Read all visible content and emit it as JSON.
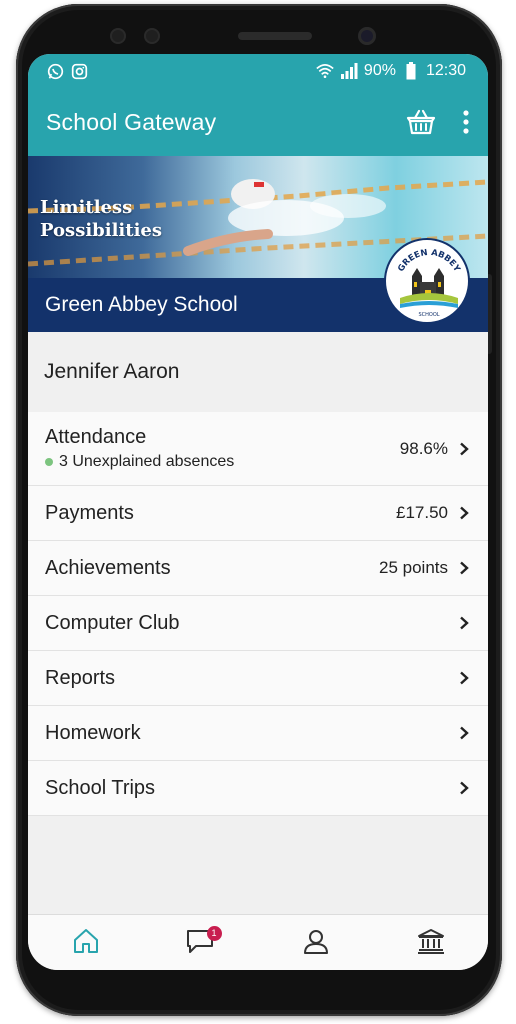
{
  "status_bar": {
    "left_icons": [
      "whatsapp-icon",
      "instagram-icon"
    ],
    "battery": "90%",
    "time": "12:30"
  },
  "app_bar": {
    "title": "School Gateway",
    "basket_icon": "basket-icon",
    "menu_icon": "more-vertical-icon"
  },
  "banner": {
    "tagline_line1": "Limitless",
    "tagline_line2": "Possibilities",
    "school_name": "Green Abbey School",
    "logo_top_text": "GREEN ABBEY",
    "logo_bottom_text": "SCHOOL"
  },
  "student": {
    "name": "Jennifer Aaron"
  },
  "menu": {
    "attendance": {
      "label": "Attendance",
      "sub": "3 Unexplained absences",
      "value": "98.6%"
    },
    "payments": {
      "label": "Payments",
      "value": "£17.50"
    },
    "achievements": {
      "label": "Achievements",
      "value": "25 points"
    },
    "computer_club": {
      "label": "Computer Club"
    },
    "reports": {
      "label": "Reports"
    },
    "homework": {
      "label": "Homework"
    },
    "school_trips": {
      "label": "School Trips"
    }
  },
  "bottom_nav": {
    "messages_badge": "1",
    "items": [
      "home-icon",
      "messages-icon",
      "profile-icon",
      "school-icon"
    ]
  },
  "colors": {
    "primary": "#28a4ad",
    "banner_stripe": "#13326b",
    "badge": "#c81e4f",
    "status_dot": "#7cc47f"
  }
}
